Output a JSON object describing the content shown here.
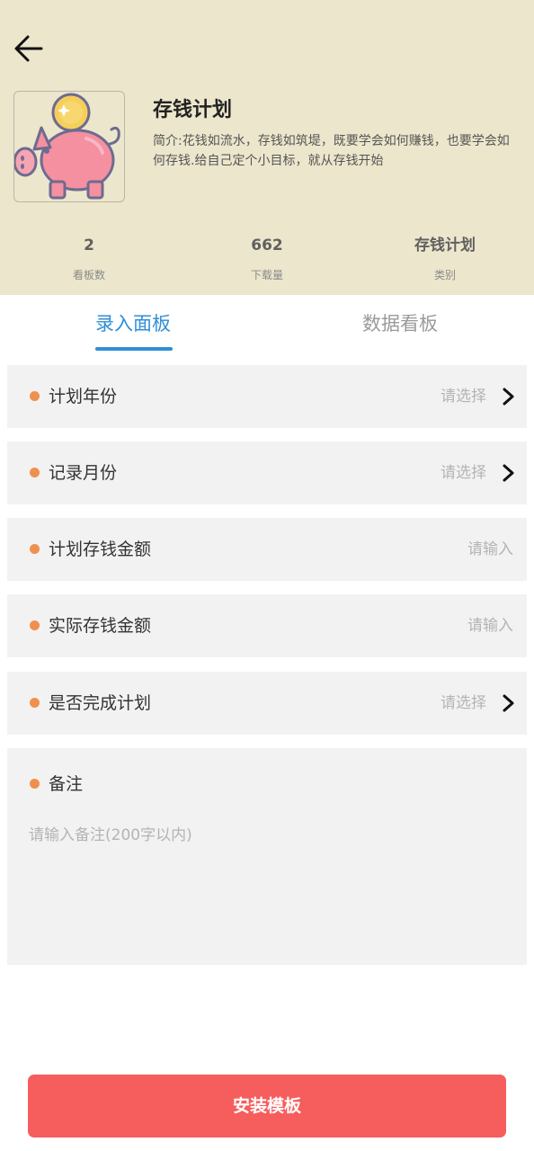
{
  "header": {
    "title": "存钱计划",
    "description": "简介:花钱如流水，存钱如筑堤，既要学会如何赚钱，也要学会如何存钱.给自己定个小目标，就从存钱开始",
    "thumbnail_icon": "piggy-bank-coin-icon",
    "back_icon": "back-arrow-icon"
  },
  "stats": [
    {
      "value": "2",
      "label": "看板数"
    },
    {
      "value": "662",
      "label": "下载量"
    },
    {
      "value": "存钱计划",
      "label": "类别"
    }
  ],
  "tabs": [
    {
      "label": "录入面板",
      "active": true
    },
    {
      "label": "数据看板",
      "active": false
    }
  ],
  "form": {
    "fields": [
      {
        "label": "计划年份",
        "placeholder": "请选择",
        "type": "select"
      },
      {
        "label": "记录月份",
        "placeholder": "请选择",
        "type": "select"
      },
      {
        "label": "计划存钱金额",
        "placeholder": "请输入",
        "type": "input"
      },
      {
        "label": "实际存钱金额",
        "placeholder": "请输入",
        "type": "input"
      },
      {
        "label": "是否完成计划",
        "placeholder": "请选择",
        "type": "select"
      }
    ],
    "notes": {
      "label": "备注",
      "placeholder": "请输入备注(200字以内)"
    }
  },
  "install_button": "安装模板",
  "colors": {
    "header_bg": "#ece6cc",
    "accent_blue": "#2f8fd8",
    "dot_orange": "#f0904f",
    "button_red": "#f65d5d"
  }
}
